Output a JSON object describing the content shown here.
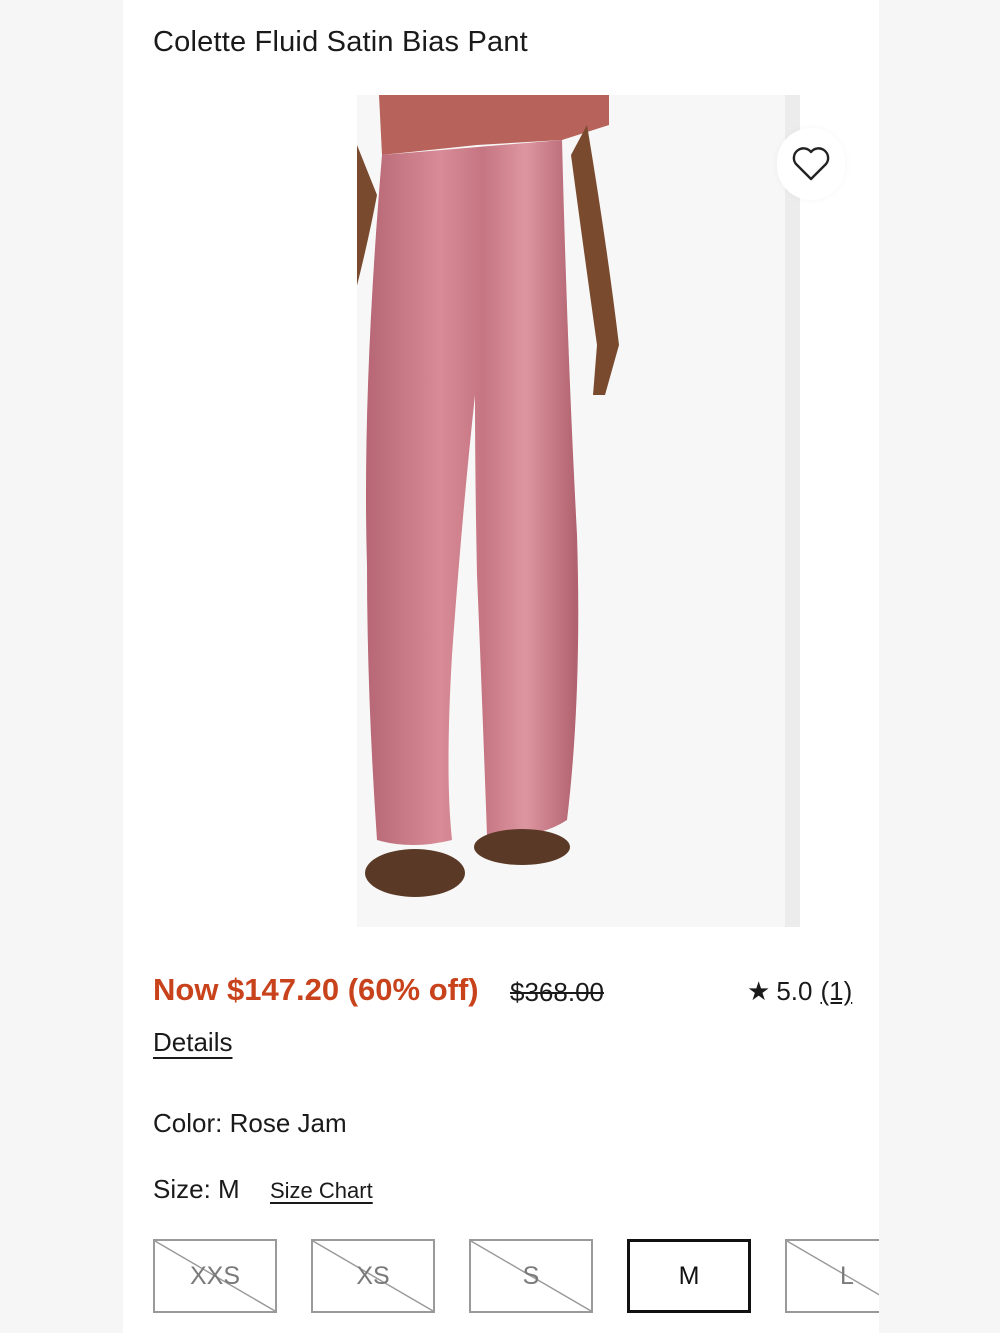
{
  "product": {
    "title": "Colette Fluid Satin Bias Pant",
    "now_price": "Now $147.20 (60% off)",
    "original_price": "$368.00",
    "rating_value": "5.0",
    "rating_count": "(1)",
    "details_label": "Details",
    "color_label": "Color:",
    "color_value": "Rose Jam",
    "size_label": "Size:",
    "size_value": "M",
    "size_chart_label": "Size Chart"
  },
  "sizes": [
    {
      "label": "XXS",
      "available": false,
      "selected": false
    },
    {
      "label": "XS",
      "available": false,
      "selected": false
    },
    {
      "label": "S",
      "available": false,
      "selected": false
    },
    {
      "label": "M",
      "available": true,
      "selected": true
    },
    {
      "label": "L",
      "available": false,
      "selected": false
    }
  ],
  "icons": {
    "favorite": "heart-outline-icon",
    "rating": "star-icon"
  },
  "colors": {
    "sale_price": "#c8431c",
    "pant": "#c97a86"
  }
}
